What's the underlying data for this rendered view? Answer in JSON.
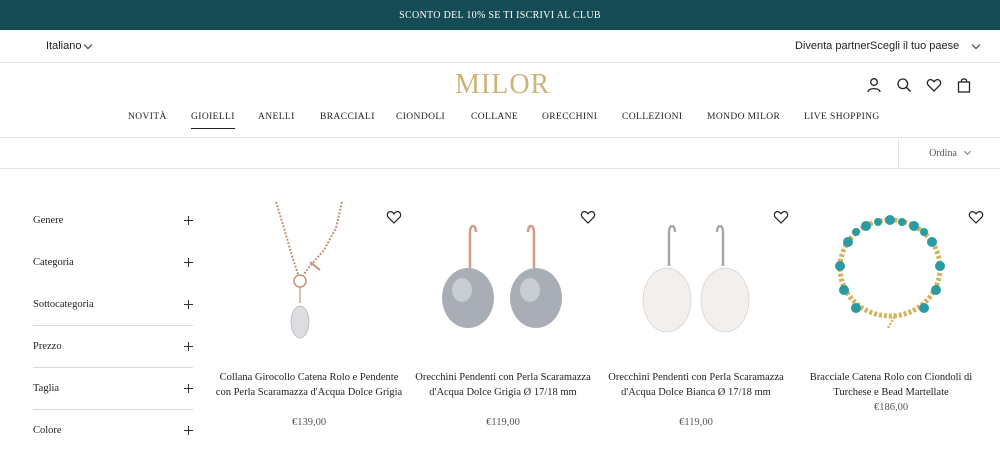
{
  "promo": "SCONTO DEL 10% SE TI ISCRIVI AL CLUB",
  "util": {
    "language": "Italiano",
    "partner": "Diventa partner",
    "country": "Scegli il tuo paese"
  },
  "brand": "MILOR",
  "colors": {
    "promo_bg": "#154b54",
    "logo": "#cdb37a"
  },
  "nav": [
    "NOVITÀ",
    "GIOIELLI",
    "ANELLI",
    "BRACCIALI",
    "CIONDOLI",
    "COLLANE",
    "ORECCHINI",
    "COLLEZIONI",
    "MONDO MILOR",
    "LIVE SHOPPING"
  ],
  "nav_active": "GIOIELLI",
  "sort_label": "Ordina",
  "filters": [
    "Genere",
    "Categoria",
    "Sottocategoria",
    "Prezzo",
    "Taglia",
    "Colore"
  ],
  "products": [
    {
      "name": "Collana Girocollo Catena Rolo e Pendente con Perla Scaramazza d'Acqua Dolce Grigia",
      "price": "€139,00"
    },
    {
      "name": "Orecchini Pendenti con Perla Scaramazza d'Acqua Dolce Grigia Ø 17/18 mm",
      "price": "€119,00"
    },
    {
      "name": "Orecchini Pendenti con Perla Scaramazza d'Acqua Dolce Bianca Ø 17/18 mm",
      "price": "€119,00"
    },
    {
      "name": "Bracciale Catena Rolo con Ciondoli di Turchese e Bead Martellate",
      "price": "€186,00"
    }
  ]
}
